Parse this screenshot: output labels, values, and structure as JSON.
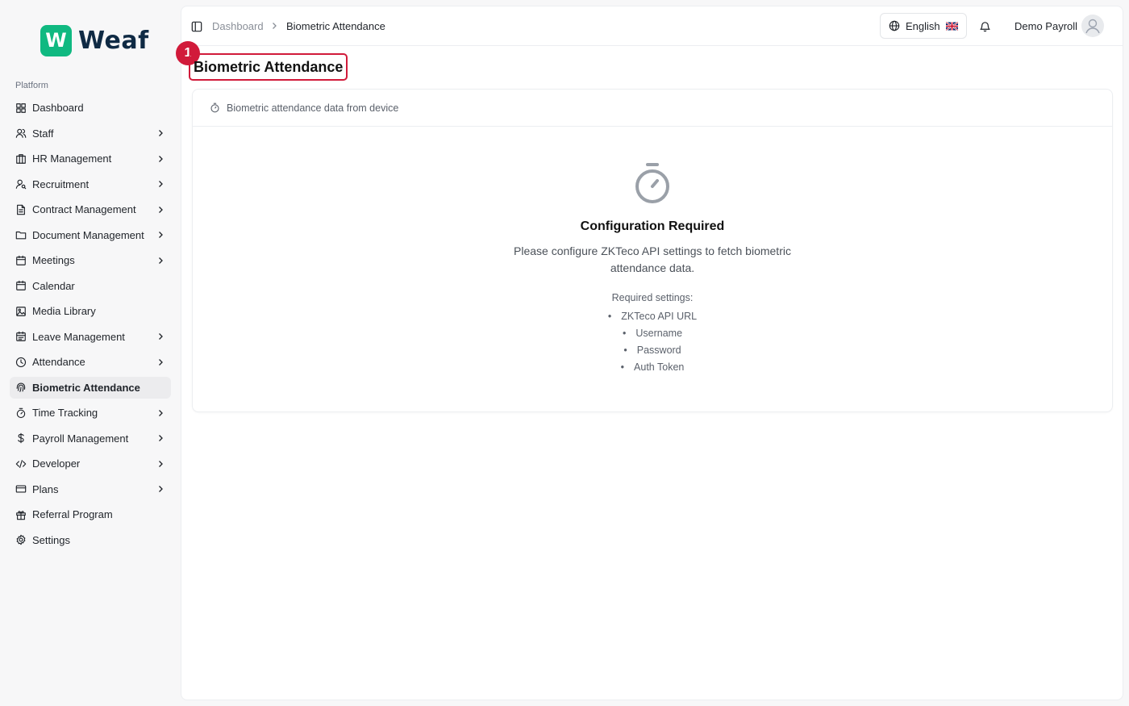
{
  "brand": {
    "mark": "W",
    "name": "Weaf",
    "accent": "#10b981"
  },
  "sidebar": {
    "section_label": "Platform",
    "items": [
      {
        "label": "Dashboard",
        "icon": "grid-icon",
        "chevron": false,
        "active": false
      },
      {
        "label": "Staff",
        "icon": "users-icon",
        "chevron": true,
        "active": false
      },
      {
        "label": "HR Management",
        "icon": "building-icon",
        "chevron": true,
        "active": false
      },
      {
        "label": "Recruitment",
        "icon": "user-search-icon",
        "chevron": true,
        "active": false
      },
      {
        "label": "Contract Management",
        "icon": "file-icon",
        "chevron": true,
        "active": false
      },
      {
        "label": "Document Management",
        "icon": "folder-icon",
        "chevron": true,
        "active": false
      },
      {
        "label": "Meetings",
        "icon": "calendar-icon",
        "chevron": true,
        "active": false
      },
      {
        "label": "Calendar",
        "icon": "calendar-icon",
        "chevron": false,
        "active": false
      },
      {
        "label": "Media Library",
        "icon": "image-icon",
        "chevron": false,
        "active": false
      },
      {
        "label": "Leave Management",
        "icon": "calendar-days-icon",
        "chevron": true,
        "active": false
      },
      {
        "label": "Attendance",
        "icon": "clock-icon",
        "chevron": true,
        "active": false
      },
      {
        "label": "Biometric Attendance",
        "icon": "fingerprint-icon",
        "chevron": false,
        "active": true
      },
      {
        "label": "Time Tracking",
        "icon": "timer-icon",
        "chevron": true,
        "active": false
      },
      {
        "label": "Payroll Management",
        "icon": "dollar-icon",
        "chevron": true,
        "active": false
      },
      {
        "label": "Developer",
        "icon": "code-icon",
        "chevron": true,
        "active": false
      },
      {
        "label": "Plans",
        "icon": "credit-card-icon",
        "chevron": true,
        "active": false
      },
      {
        "label": "Referral Program",
        "icon": "gift-icon",
        "chevron": false,
        "active": false
      },
      {
        "label": "Settings",
        "icon": "gear-icon",
        "chevron": false,
        "active": false
      }
    ]
  },
  "header": {
    "breadcrumb": [
      "Dashboard",
      "Biometric Attendance"
    ],
    "language": "English",
    "user_name": "Demo Payroll"
  },
  "page": {
    "title": "Biometric Attendance",
    "annotation_number": "1",
    "card_title": "Biometric attendance data from device",
    "empty_title": "Configuration Required",
    "empty_desc": "Please configure ZKTeco API settings to fetch biometric attendance data.",
    "required_label": "Required settings:",
    "required_items": [
      "ZKTeco API URL",
      "Username",
      "Password",
      "Auth Token"
    ]
  },
  "colors": {
    "annotation": "#d11a3a",
    "active_bg": "#ececee"
  }
}
